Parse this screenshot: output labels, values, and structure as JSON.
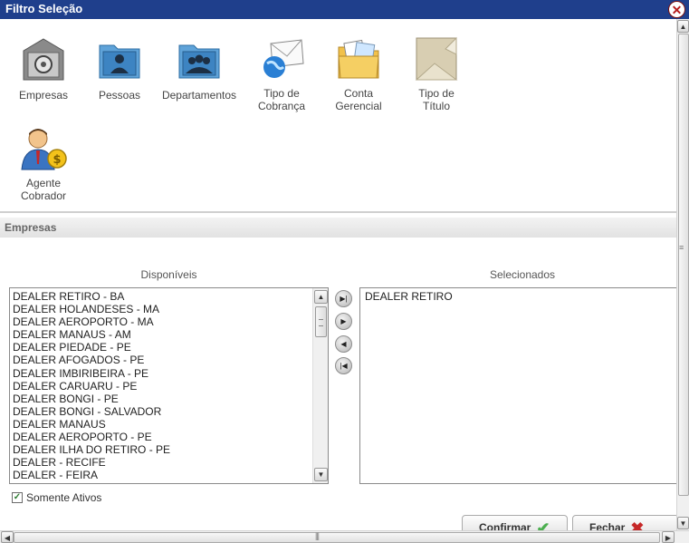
{
  "window": {
    "title": "Filtro Seleção",
    "close_icon": "close-icon"
  },
  "tiles": [
    {
      "label": "Empresas",
      "icon": "safe-icon"
    },
    {
      "label": "Pessoas",
      "icon": "person-folder-icon"
    },
    {
      "label": "Departamentos",
      "icon": "group-folder-icon"
    },
    {
      "label": "Tipo de Cobrança",
      "icon": "envelope-globe-icon"
    },
    {
      "label": "Conta Gerencial",
      "icon": "documents-folder-icon"
    },
    {
      "label": "Tipo de Título",
      "icon": "paper-icon"
    },
    {
      "label": "Agente Cobrador",
      "icon": "agent-money-icon"
    }
  ],
  "section": {
    "title": "Empresas"
  },
  "lists": {
    "available_title": "Disponíveis",
    "selected_title": "Selecionados",
    "available": [
      "DEALER RETIRO - BA",
      "DEALER HOLANDESES - MA",
      "DEALER AEROPORTO - MA",
      "DEALER MANAUS - AM",
      "DEALER PIEDADE - PE",
      "DEALER AFOGADOS - PE",
      "DEALER IMBIRIBEIRA - PE",
      "DEALER CARUARU - PE",
      "DEALER BONGI - PE",
      "DEALER BONGI - SALVADOR",
      "DEALER MANAUS",
      "DEALER AEROPORTO - PE",
      "DEALER ILHA DO RETIRO - PE",
      "DEALER - RECIFE",
      "DEALER - FEIRA"
    ],
    "selected": [
      "DEALER RETIRO"
    ]
  },
  "options": {
    "active_only_label": "Somente Ativos",
    "active_only_checked": true
  },
  "buttons": {
    "confirm": "Confirmar",
    "close": "Fechar"
  },
  "colors": {
    "titlebar": "#1f3f8c",
    "confirm_check": "#4caf50",
    "close_x": "#c62828"
  }
}
